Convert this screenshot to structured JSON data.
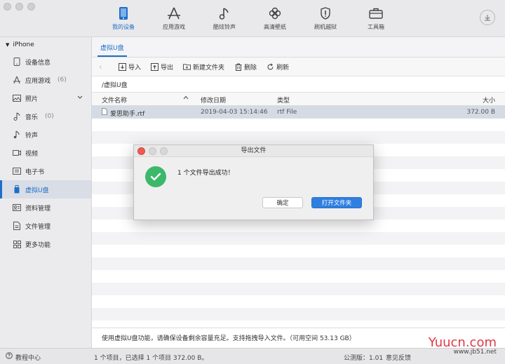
{
  "topnav": {
    "items": [
      {
        "label": "我的设备",
        "icon": "phone-icon",
        "active": true
      },
      {
        "label": "应用游戏",
        "icon": "app-store-icon"
      },
      {
        "label": "酷炫铃声",
        "icon": "music-note-icon"
      },
      {
        "label": "高清壁纸",
        "icon": "flower-icon"
      },
      {
        "label": "刷机越狱",
        "icon": "shield-icon"
      },
      {
        "label": "工具箱",
        "icon": "toolbox-icon"
      }
    ]
  },
  "sidebar": {
    "device": "iPhone",
    "items": [
      {
        "label": "设备信息",
        "icon": "device-info-icon"
      },
      {
        "label": "应用游戏",
        "icon": "app-icon",
        "count": "(6)"
      },
      {
        "label": "照片",
        "icon": "photo-icon",
        "expandable": true
      },
      {
        "label": "音乐",
        "icon": "music-icon",
        "count": "(0)"
      },
      {
        "label": "铃声",
        "icon": "ringtone-icon"
      },
      {
        "label": "视频",
        "icon": "video-icon"
      },
      {
        "label": "电子书",
        "icon": "book-icon"
      },
      {
        "label": "虚拟U盘",
        "icon": "usb-icon",
        "active": true
      },
      {
        "label": "资料管理",
        "icon": "contacts-icon"
      },
      {
        "label": "文件管理",
        "icon": "file-icon"
      },
      {
        "label": "更多功能",
        "icon": "grid-icon"
      }
    ]
  },
  "main": {
    "tab": "虚拟U盘",
    "actions": {
      "import": "导入",
      "export": "导出",
      "new_folder": "新建文件夹",
      "delete": "删除",
      "refresh": "刷新"
    },
    "path": "/虚拟U盘",
    "columns": {
      "name": "文件名称",
      "date": "修改日期",
      "type": "类型",
      "size": "大小"
    },
    "files": [
      {
        "name": "爱思助手.rtf",
        "date": "2019-04-03 15:14:46",
        "type": "rtf File",
        "size": "372.00 B"
      }
    ],
    "footer_note": "使用虚拟U盘功能，请确保设备剩余容量充足。支持拖拽导入文件。（可用空间 53.13 GB）"
  },
  "statusbar": {
    "help": "教程中心",
    "selection": "1 个项目，已选择 1 个项目 372.00 B。",
    "version": "公测版：1.01",
    "feedback": "意见反馈"
  },
  "dialog": {
    "title": "导出文件",
    "message": "1 个文件导出成功！",
    "confirm": "确定",
    "open_folder": "打开文件夹"
  },
  "watermark": {
    "brand": "Yuucn.com",
    "url": "www.jb51.net"
  }
}
